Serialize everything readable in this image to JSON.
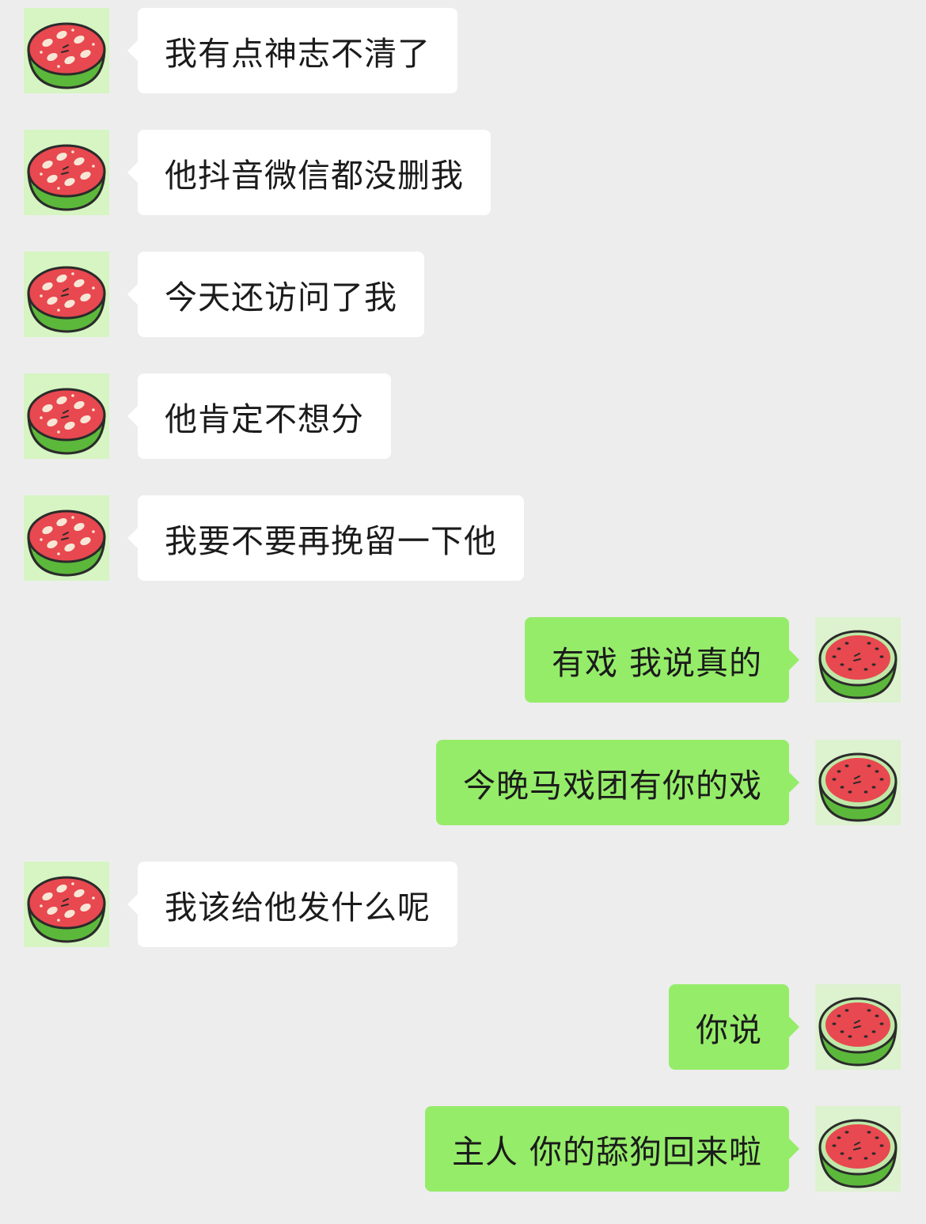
{
  "messages": [
    {
      "side": "in",
      "text": "我有点神志不清了"
    },
    {
      "side": "in",
      "text": "他抖音微信都没删我"
    },
    {
      "side": "in",
      "text": "今天还访问了我"
    },
    {
      "side": "in",
      "text": "他肯定不想分"
    },
    {
      "side": "in",
      "text": "我要不要再挽留一下他"
    },
    {
      "side": "out",
      "text": "有戏 我说真的"
    },
    {
      "side": "out",
      "text": "今晚马戏团有你的戏"
    },
    {
      "side": "in",
      "text": "我该给他发什么呢"
    },
    {
      "side": "out",
      "text": "你说"
    },
    {
      "side": "out",
      "text": "主人 你的舔狗回来啦"
    }
  ],
  "avatars": {
    "in": "watermelon-bowl-icon",
    "out": "watermelon-slice-icon"
  },
  "colors": {
    "background": "#ededed",
    "incoming_bubble": "#ffffff",
    "outgoing_bubble": "#95ec69"
  }
}
